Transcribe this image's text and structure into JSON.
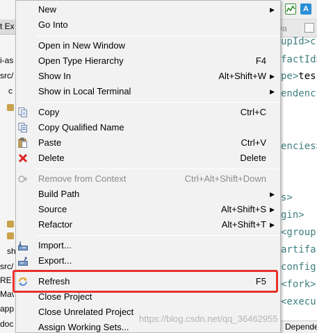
{
  "background": {
    "left_tab_text": "t Ex",
    "left_rows": [
      "i-as",
      "src/",
      "c",
      "",
      "",
      "",
      "",
      "",
      "src/",
      "sh",
      "src/",
      "RE",
      "Mav",
      "appl",
      "doc"
    ],
    "editor_tab": "va",
    "code_lines": [
      {
        "tag": "upId>c",
        "txt": ""
      },
      {
        "tag": "factId>",
        "txt": ""
      },
      {
        "tag": "pe>",
        "txt": "tes"
      },
      {
        "tag": "endency",
        "txt": ""
      },
      {
        "tag": "encies>",
        "txt": ""
      },
      {
        "tag": "s>",
        "txt": ""
      },
      {
        "tag": "gin>",
        "txt": ""
      },
      {
        "tag": "<groupIc",
        "txt": ""
      },
      {
        "tag": "artifactI",
        "txt": ""
      },
      {
        "tag": "configur",
        "txt": ""
      },
      {
        "tag": "<fork>",
        "txt": ""
      },
      {
        "tag": "<execu",
        "txt": ""
      }
    ],
    "status_text": "Depende"
  },
  "menu": {
    "items": [
      {
        "label": "New",
        "shortcut": "",
        "submenu": true,
        "disabled": false,
        "icon": ""
      },
      {
        "label": "Go Into",
        "shortcut": "",
        "submenu": false,
        "disabled": false,
        "icon": ""
      },
      {
        "label": "Open in New Window",
        "shortcut": "",
        "submenu": false,
        "disabled": false,
        "icon": ""
      },
      {
        "label": "Open Type Hierarchy",
        "shortcut": "F4",
        "submenu": false,
        "disabled": false,
        "icon": ""
      },
      {
        "label": "Show In",
        "shortcut": "Alt+Shift+W",
        "submenu": true,
        "disabled": false,
        "icon": ""
      },
      {
        "label": "Show in Local Terminal",
        "shortcut": "",
        "submenu": true,
        "disabled": false,
        "icon": ""
      },
      {
        "label": "Copy",
        "shortcut": "Ctrl+C",
        "submenu": false,
        "disabled": false,
        "icon": "copy-icon"
      },
      {
        "label": "Copy Qualified Name",
        "shortcut": "",
        "submenu": false,
        "disabled": false,
        "icon": "copy-qualified-icon"
      },
      {
        "label": "Paste",
        "shortcut": "Ctrl+V",
        "submenu": false,
        "disabled": false,
        "icon": "paste-icon"
      },
      {
        "label": "Delete",
        "shortcut": "Delete",
        "submenu": false,
        "disabled": false,
        "icon": "delete-icon"
      },
      {
        "label": "Remove from Context",
        "shortcut": "Ctrl+Alt+Shift+Down",
        "submenu": false,
        "disabled": true,
        "icon": "remove-context-icon"
      },
      {
        "label": "Build Path",
        "shortcut": "",
        "submenu": true,
        "disabled": false,
        "icon": ""
      },
      {
        "label": "Source",
        "shortcut": "Alt+Shift+S",
        "submenu": true,
        "disabled": false,
        "icon": ""
      },
      {
        "label": "Refactor",
        "shortcut": "Alt+Shift+T",
        "submenu": true,
        "disabled": false,
        "icon": ""
      },
      {
        "label": "Import...",
        "shortcut": "",
        "submenu": false,
        "disabled": false,
        "icon": "import-icon"
      },
      {
        "label": "Export...",
        "shortcut": "",
        "submenu": false,
        "disabled": false,
        "icon": "export-icon"
      },
      {
        "label": "Refresh",
        "shortcut": "F5",
        "submenu": false,
        "disabled": false,
        "icon": "refresh-icon"
      },
      {
        "label": "Close Project",
        "shortcut": "",
        "submenu": false,
        "disabled": false,
        "icon": ""
      },
      {
        "label": "Close Unrelated Project",
        "shortcut": "",
        "submenu": false,
        "disabled": false,
        "icon": ""
      },
      {
        "label": "Assign Working Sets...",
        "shortcut": "",
        "submenu": false,
        "disabled": false,
        "icon": ""
      }
    ]
  },
  "highlight_color": "#e8302b",
  "watermark": "https://blog.csdn.net/qq_36462955"
}
